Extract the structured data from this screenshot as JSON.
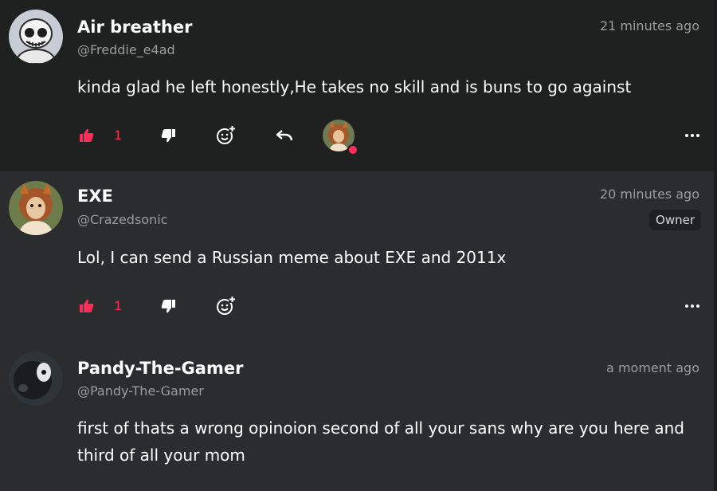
{
  "comments": [
    {
      "author": "Air breather",
      "handle": "@Freddie_e4ad",
      "time": "21 minutes ago",
      "text": "kinda glad he left honestly,He takes no skill and is buns to go against",
      "likes": "1",
      "avatar_icon": "skull-avatar-icon",
      "has_reply_avatar": true
    },
    {
      "author": "EXE",
      "handle": "@Crazedsonic",
      "time": "20 minutes ago",
      "badge": "Owner",
      "text": "Lol, I can send a Russian meme about EXE and 2011x",
      "likes": "1",
      "avatar_icon": "fox-character-avatar-icon"
    },
    {
      "author": "Pandy-The-Gamer",
      "handle": "@Pandy-The-Gamer",
      "time": "a moment ago",
      "text": "first of thats a wrong opinoion second of all your sans why are you here and third of all your mom",
      "avatar_icon": "dark-character-avatar-icon"
    }
  ],
  "colors": {
    "accent": "#ff2d5a",
    "background": "#2a2c2d",
    "highlight_bg": "#1f2020",
    "muted_text": "#9a9d9e"
  }
}
